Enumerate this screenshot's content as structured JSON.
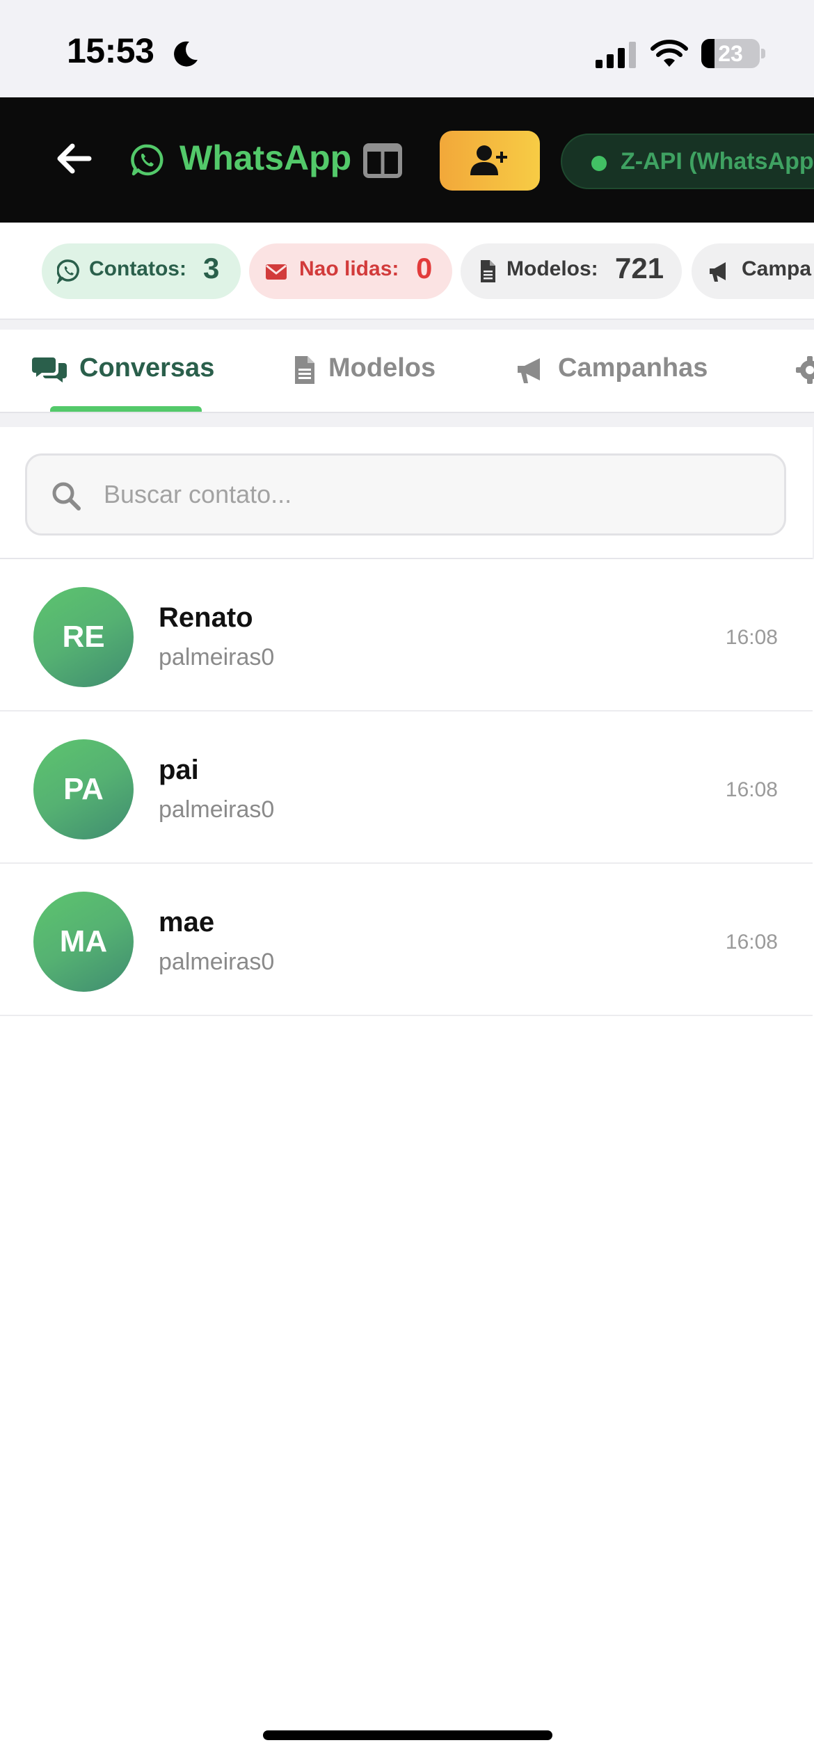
{
  "status_bar": {
    "time": "15:53",
    "battery": "23",
    "battery_level": 0.23,
    "icons": [
      "moon-icon",
      "signal-icon",
      "wifi-icon",
      "battery-icon"
    ]
  },
  "header": {
    "title": "WhatsApp",
    "connection_label": "Z-API (WhatsApp",
    "icons": [
      "back-arrow-icon",
      "whatsapp-icon",
      "columns-layout-icon",
      "add-user-icon"
    ],
    "colors": {
      "title": "#53c96a",
      "add_button": "#f5b83f",
      "header_bg": "#0b0b0b",
      "connection_dot": "#42c064"
    }
  },
  "stats": {
    "contacts": {
      "label": "Contatos:",
      "value": "3"
    },
    "unread": {
      "label": "Nao lidas:",
      "value": "0"
    },
    "models": {
      "label": "Modelos:",
      "value": "721"
    },
    "campaigns": {
      "label": "Campa"
    }
  },
  "tabs": [
    {
      "label": "Conversas",
      "icon": "chat-bubbles-icon",
      "active": true
    },
    {
      "label": "Modelos",
      "icon": "document-icon",
      "active": false
    },
    {
      "label": "Campanhas",
      "icon": "megaphone-icon",
      "active": false
    },
    {
      "label": "",
      "icon": "gear-icon",
      "active": false
    }
  ],
  "search": {
    "placeholder": "Buscar contato...",
    "value": ""
  },
  "conversations": [
    {
      "initials": "RE",
      "name": "Renato",
      "preview": "palmeiras0",
      "time": "16:08"
    },
    {
      "initials": "PA",
      "name": "pai",
      "preview": "palmeiras0",
      "time": "16:08"
    },
    {
      "initials": "MA",
      "name": "mae",
      "preview": "palmeiras0",
      "time": "16:08"
    }
  ]
}
